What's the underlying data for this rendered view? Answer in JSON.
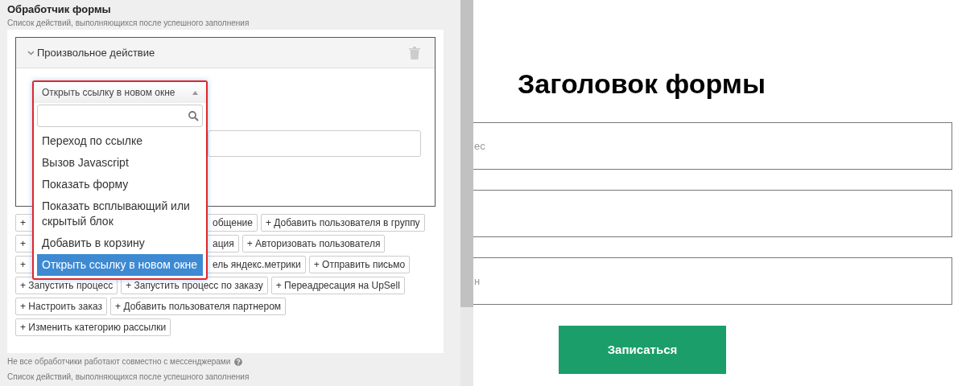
{
  "panel": {
    "title": "Обработчик формы",
    "subtitle": "Список действий, выполняющихся после успешного заполнения",
    "action": {
      "title": "Произвольное действие",
      "expanded": true
    },
    "dropdown": {
      "value": "Открыть ссылку в новом окне",
      "open": true,
      "options": [
        {
          "label": "Переход по ссылке",
          "selected": false
        },
        {
          "label": "Вызов Javascript",
          "selected": false
        },
        {
          "label": "Показать форму",
          "selected": false
        },
        {
          "label": "Показать всплывающий или скрытый блок",
          "selected": false
        },
        {
          "label": "Добавить в корзину",
          "selected": false
        },
        {
          "label": "Открыть ссылку в новом окне",
          "selected": true
        }
      ]
    },
    "add_buttons": [
      [
        {
          "label": "+",
          "kind": "covered_end"
        },
        {
          "label": "общение",
          "kind": "covered_start"
        },
        {
          "label": "+ Добавить пользователя в группу",
          "kind": "full"
        }
      ],
      [
        {
          "label": "+",
          "kind": "covered_end"
        },
        {
          "label": "ация",
          "kind": "covered_start"
        },
        {
          "label": "+ Авторизовать пользователя",
          "kind": "full"
        }
      ],
      [
        {
          "label": "+",
          "kind": "covered_end"
        },
        {
          "label": "ель яндекс.метрики",
          "kind": "covered_start"
        },
        {
          "label": "+ Отправить письмо",
          "kind": "full"
        }
      ],
      [
        {
          "label": "+ Запустить процесс",
          "kind": "full"
        },
        {
          "label": "+ Запустить процесс по заказу",
          "kind": "full"
        },
        {
          "label": "+ Переадресация на UpSell",
          "kind": "full"
        }
      ],
      [
        {
          "label": "+ Настроить заказ",
          "kind": "full"
        },
        {
          "label": "+ Добавить пользователя партнером",
          "kind": "full"
        }
      ],
      [
        {
          "label": "+ Изменить категорию рассылки",
          "kind": "full"
        }
      ]
    ],
    "note": "Не все обработчики работают совместно с мессенджерами",
    "footer": "Список действий, выполняющихся после успешного заполнения"
  },
  "preview": {
    "heading": "Заголовок формы",
    "fields": [
      {
        "kind": "text",
        "placeholder": "ес"
      },
      {
        "kind": "text"
      },
      {
        "kind": "text",
        "placeholder": "н"
      }
    ],
    "submit": "Записаться"
  }
}
